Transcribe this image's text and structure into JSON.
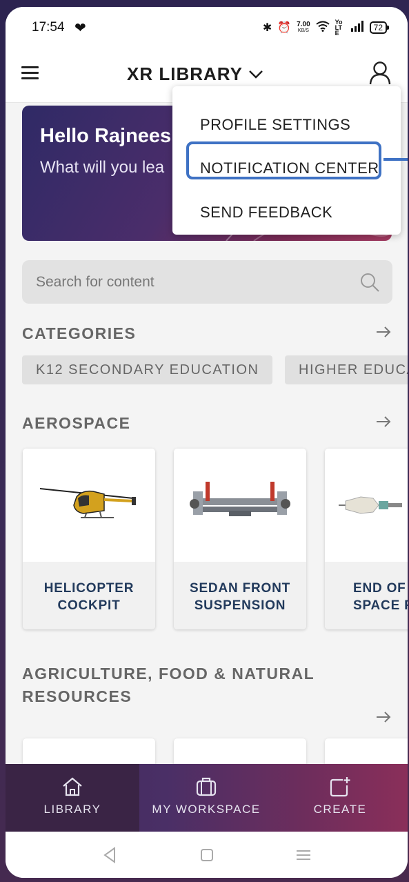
{
  "status_bar": {
    "time": "17:54",
    "speed_value": "7.00",
    "speed_unit": "KB/S",
    "network": "Yo LTE",
    "battery": "72"
  },
  "app_bar": {
    "title": "XR LIBRARY"
  },
  "hero": {
    "greeting": "Hello Rajnees",
    "subtitle": "What will you lea"
  },
  "dropdown": {
    "items": [
      {
        "label": "PROFILE SETTINGS"
      },
      {
        "label": "NOTIFICATION CENTER"
      },
      {
        "label": "SEND FEEDBACK"
      }
    ]
  },
  "search": {
    "placeholder": "Search for content"
  },
  "categories": {
    "title": "CATEGORIES",
    "chips": [
      "K12 SECONDARY EDUCATION",
      "HIGHER EDUCA"
    ]
  },
  "aerospace": {
    "title": "AEROSPACE",
    "cards": [
      {
        "line1": "HELICOPTER",
        "line2": "COCKPIT"
      },
      {
        "line1": "SEDAN FRONT",
        "line2": "SUSPENSION"
      },
      {
        "line1": "END OF T",
        "line2": "SPACE RA"
      }
    ]
  },
  "agriculture": {
    "title": "AGRICULTURE, FOOD & NATURAL RESOURCES"
  },
  "bottom_nav": {
    "items": [
      {
        "label": "LIBRARY",
        "icon": "home-icon"
      },
      {
        "label": "MY WORKSPACE",
        "icon": "briefcase-icon"
      },
      {
        "label": "CREATE",
        "icon": "create-icon"
      }
    ]
  },
  "colors": {
    "accent": "#3f72c4",
    "card_text": "#223a5c",
    "nav_active": "#3a2445"
  }
}
